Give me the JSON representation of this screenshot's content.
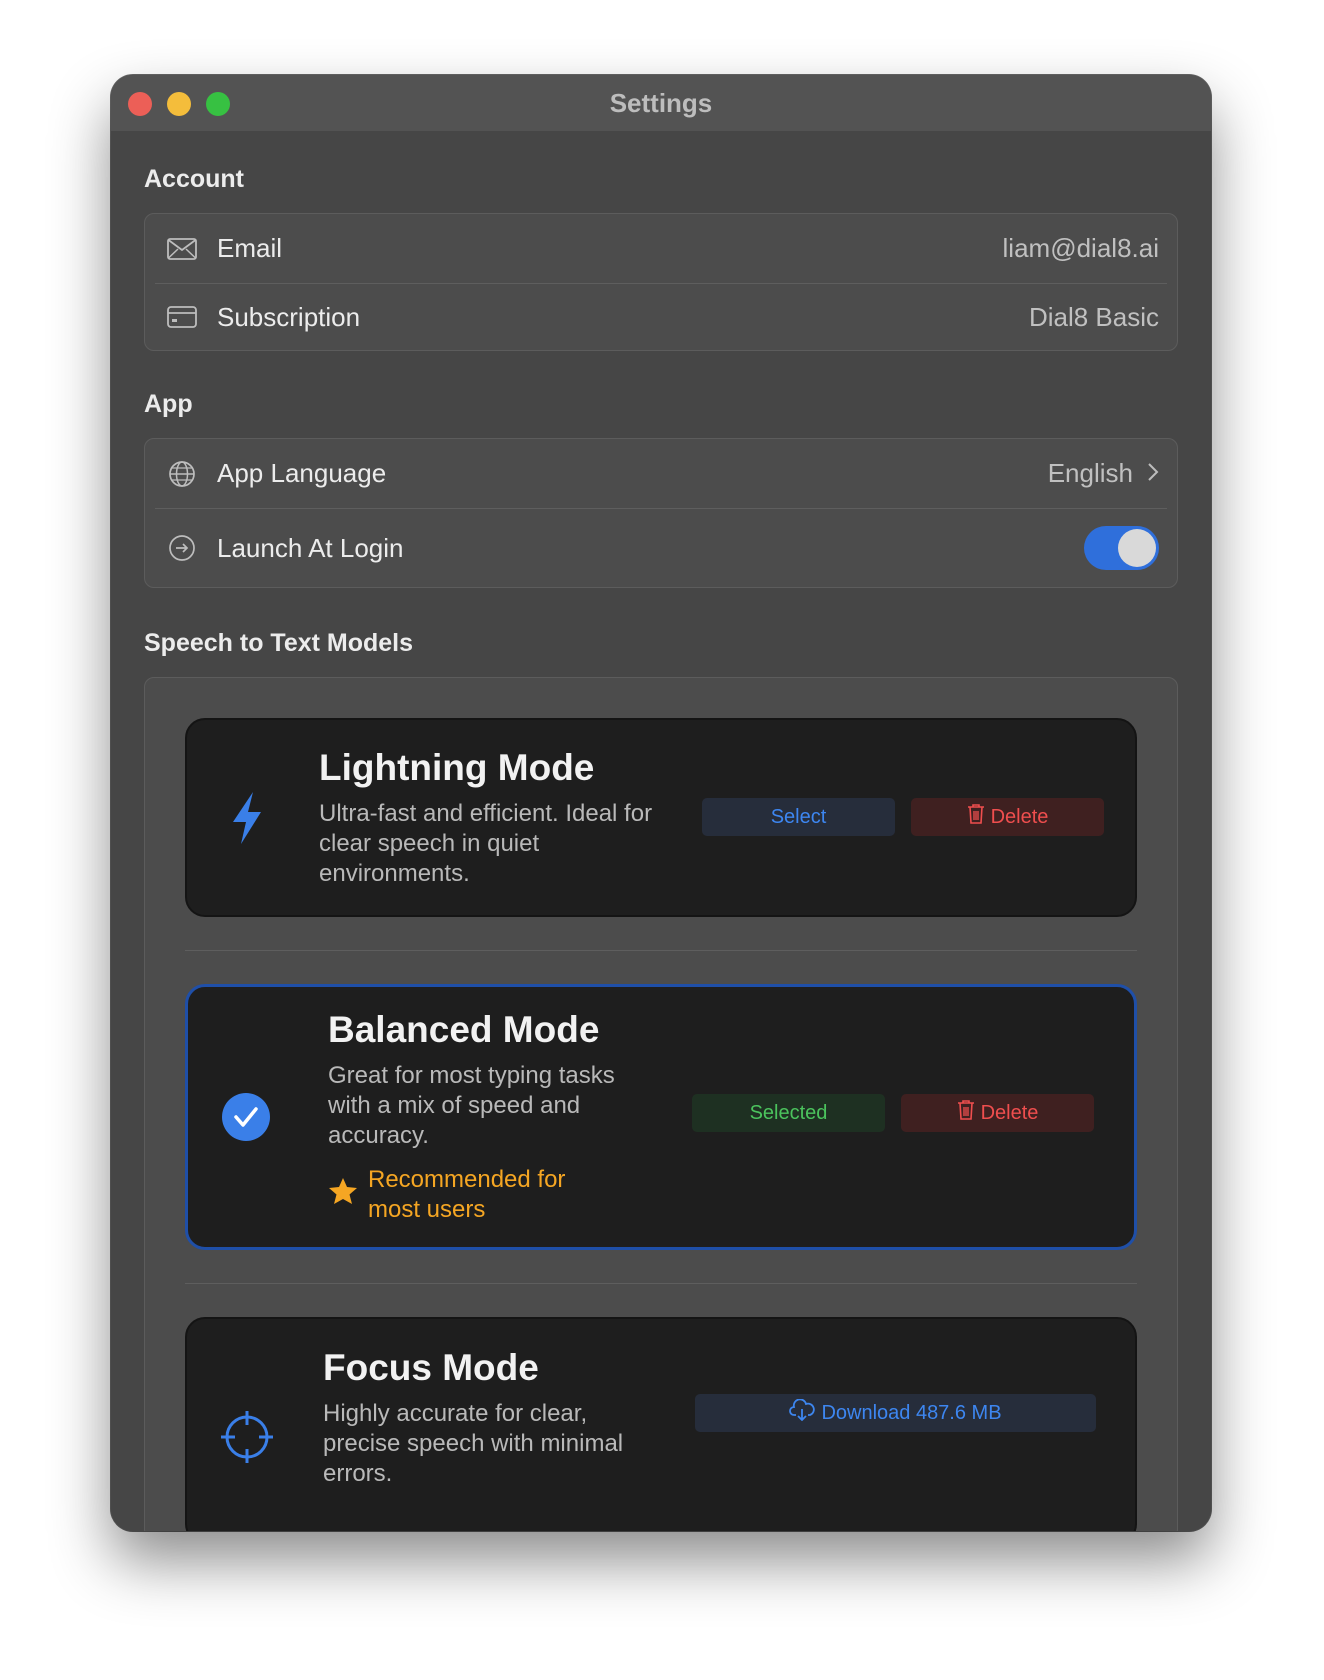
{
  "window": {
    "title": "Settings"
  },
  "account": {
    "title": "Account",
    "rows": [
      {
        "label": "Email",
        "value": "liam@dial8.ai",
        "icon": "envelope-icon"
      },
      {
        "label": "Subscription",
        "value": "Dial8 Basic",
        "icon": "credit-card-icon"
      }
    ]
  },
  "app": {
    "title": "App",
    "language": {
      "label": "App Language",
      "value": "English",
      "icon": "globe-icon"
    },
    "launch": {
      "label": "Launch At Login",
      "enabled": true,
      "icon": "login-arrow-icon"
    }
  },
  "models": {
    "title": "Speech to Text Models",
    "items": [
      {
        "name": "Lightning Mode",
        "description": "Ultra-fast and efficient. Ideal for clear speech in quiet environments.",
        "icon": "lightning-icon",
        "primary_button": "Select",
        "delete_button": "Delete",
        "selected": false
      },
      {
        "name": "Balanced Mode",
        "description": "Great for most typing tasks with a mix of speed and accuracy.",
        "icon": "checkmark-circle-icon",
        "recommendation": "Recommended for most users",
        "primary_button": "Selected",
        "delete_button": "Delete",
        "selected": true
      },
      {
        "name": "Focus Mode",
        "description": "Highly accurate for clear, precise speech with minimal errors.",
        "icon": "crosshair-icon",
        "download_button": "Download 487.6 MB",
        "selected": false
      }
    ]
  },
  "colors": {
    "accent": "#2f6fdb",
    "selected_border": "#1f4fa8",
    "recommend": "#f5a623",
    "delete": "#ef4e4e",
    "selected_text": "#4bc35d"
  }
}
